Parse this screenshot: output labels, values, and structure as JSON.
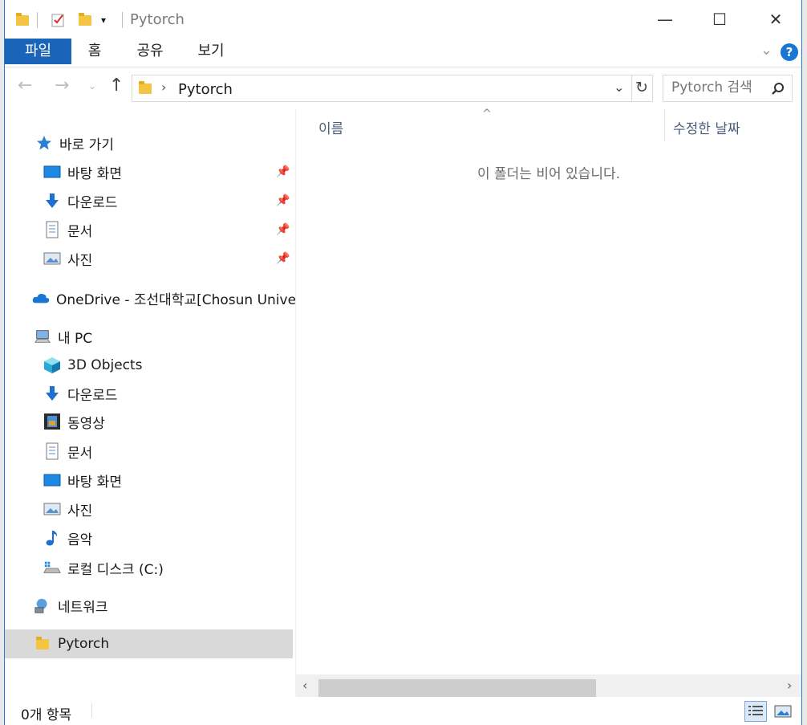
{
  "window": {
    "title": "Pytorch"
  },
  "window_controls": {
    "minimize": "—",
    "maximize": "☐",
    "close": "✕"
  },
  "ribbon": {
    "tabs": [
      {
        "label": "파일"
      },
      {
        "label": "홈"
      },
      {
        "label": "공유"
      },
      {
        "label": "보기"
      }
    ],
    "help": "?"
  },
  "address": {
    "path": "Pytorch",
    "search_placeholder": "Pytorch 검색"
  },
  "sidebar": {
    "quick_access": {
      "label": "바로 가기",
      "items": [
        {
          "label": "바탕 화면"
        },
        {
          "label": "다운로드"
        },
        {
          "label": "문서"
        },
        {
          "label": "사진"
        }
      ]
    },
    "onedrive": {
      "label": "OneDrive - 조선대학교[Chosun Unive"
    },
    "this_pc": {
      "label": "내 PC",
      "items": [
        {
          "label": "3D Objects"
        },
        {
          "label": "다운로드"
        },
        {
          "label": "동영상"
        },
        {
          "label": "문서"
        },
        {
          "label": "바탕 화면"
        },
        {
          "label": "사진"
        },
        {
          "label": "음악"
        },
        {
          "label": "로컬 디스크 (C:)"
        }
      ]
    },
    "network": {
      "label": "네트워크"
    },
    "selected": {
      "label": "Pytorch"
    }
  },
  "content": {
    "columns": {
      "name": "이름",
      "modified": "수정한 날짜"
    },
    "empty_message": "이 폴더는 비어 있습니다."
  },
  "status": {
    "items_count": "0개 항목"
  },
  "colors": {
    "accent": "#1a65b9",
    "selection": "#d9d9d9",
    "folder": "#f4c542"
  }
}
